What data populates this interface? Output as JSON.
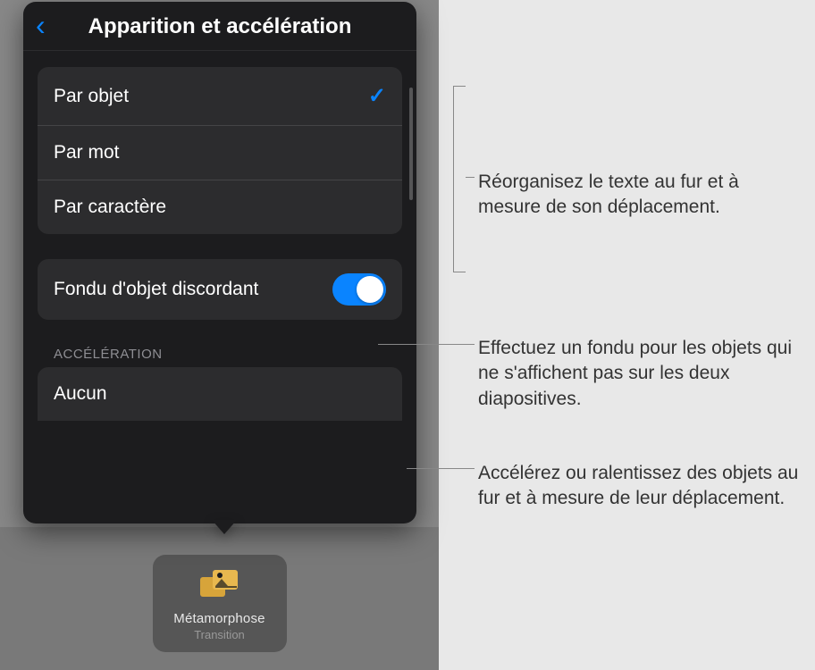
{
  "popover": {
    "title": "Apparition et accélération",
    "options": [
      {
        "label": "Par objet",
        "selected": true
      },
      {
        "label": "Par mot",
        "selected": false
      },
      {
        "label": "Par caractère",
        "selected": false
      }
    ],
    "fade_toggle": {
      "label": "Fondu d'objet discordant",
      "on": true
    },
    "acceleration": {
      "header": "ACCÉLÉRATION",
      "value": "Aucun"
    }
  },
  "transition_badge": {
    "name": "Métamorphose",
    "sub": "Transition"
  },
  "callouts": {
    "text_reorg": "Réorganisez le texte au fur et à mesure de son déplacement.",
    "fade": "Effectuez un fondu pour les objets qui ne s'affichent pas sur les deux diapositives.",
    "accel": "Accélérez ou ralentissez des objets au fur et à mesure de leur déplacement."
  },
  "colors": {
    "accent": "#0a84ff",
    "panel_bg": "#1c1c1e",
    "group_bg": "#2c2c2e"
  }
}
